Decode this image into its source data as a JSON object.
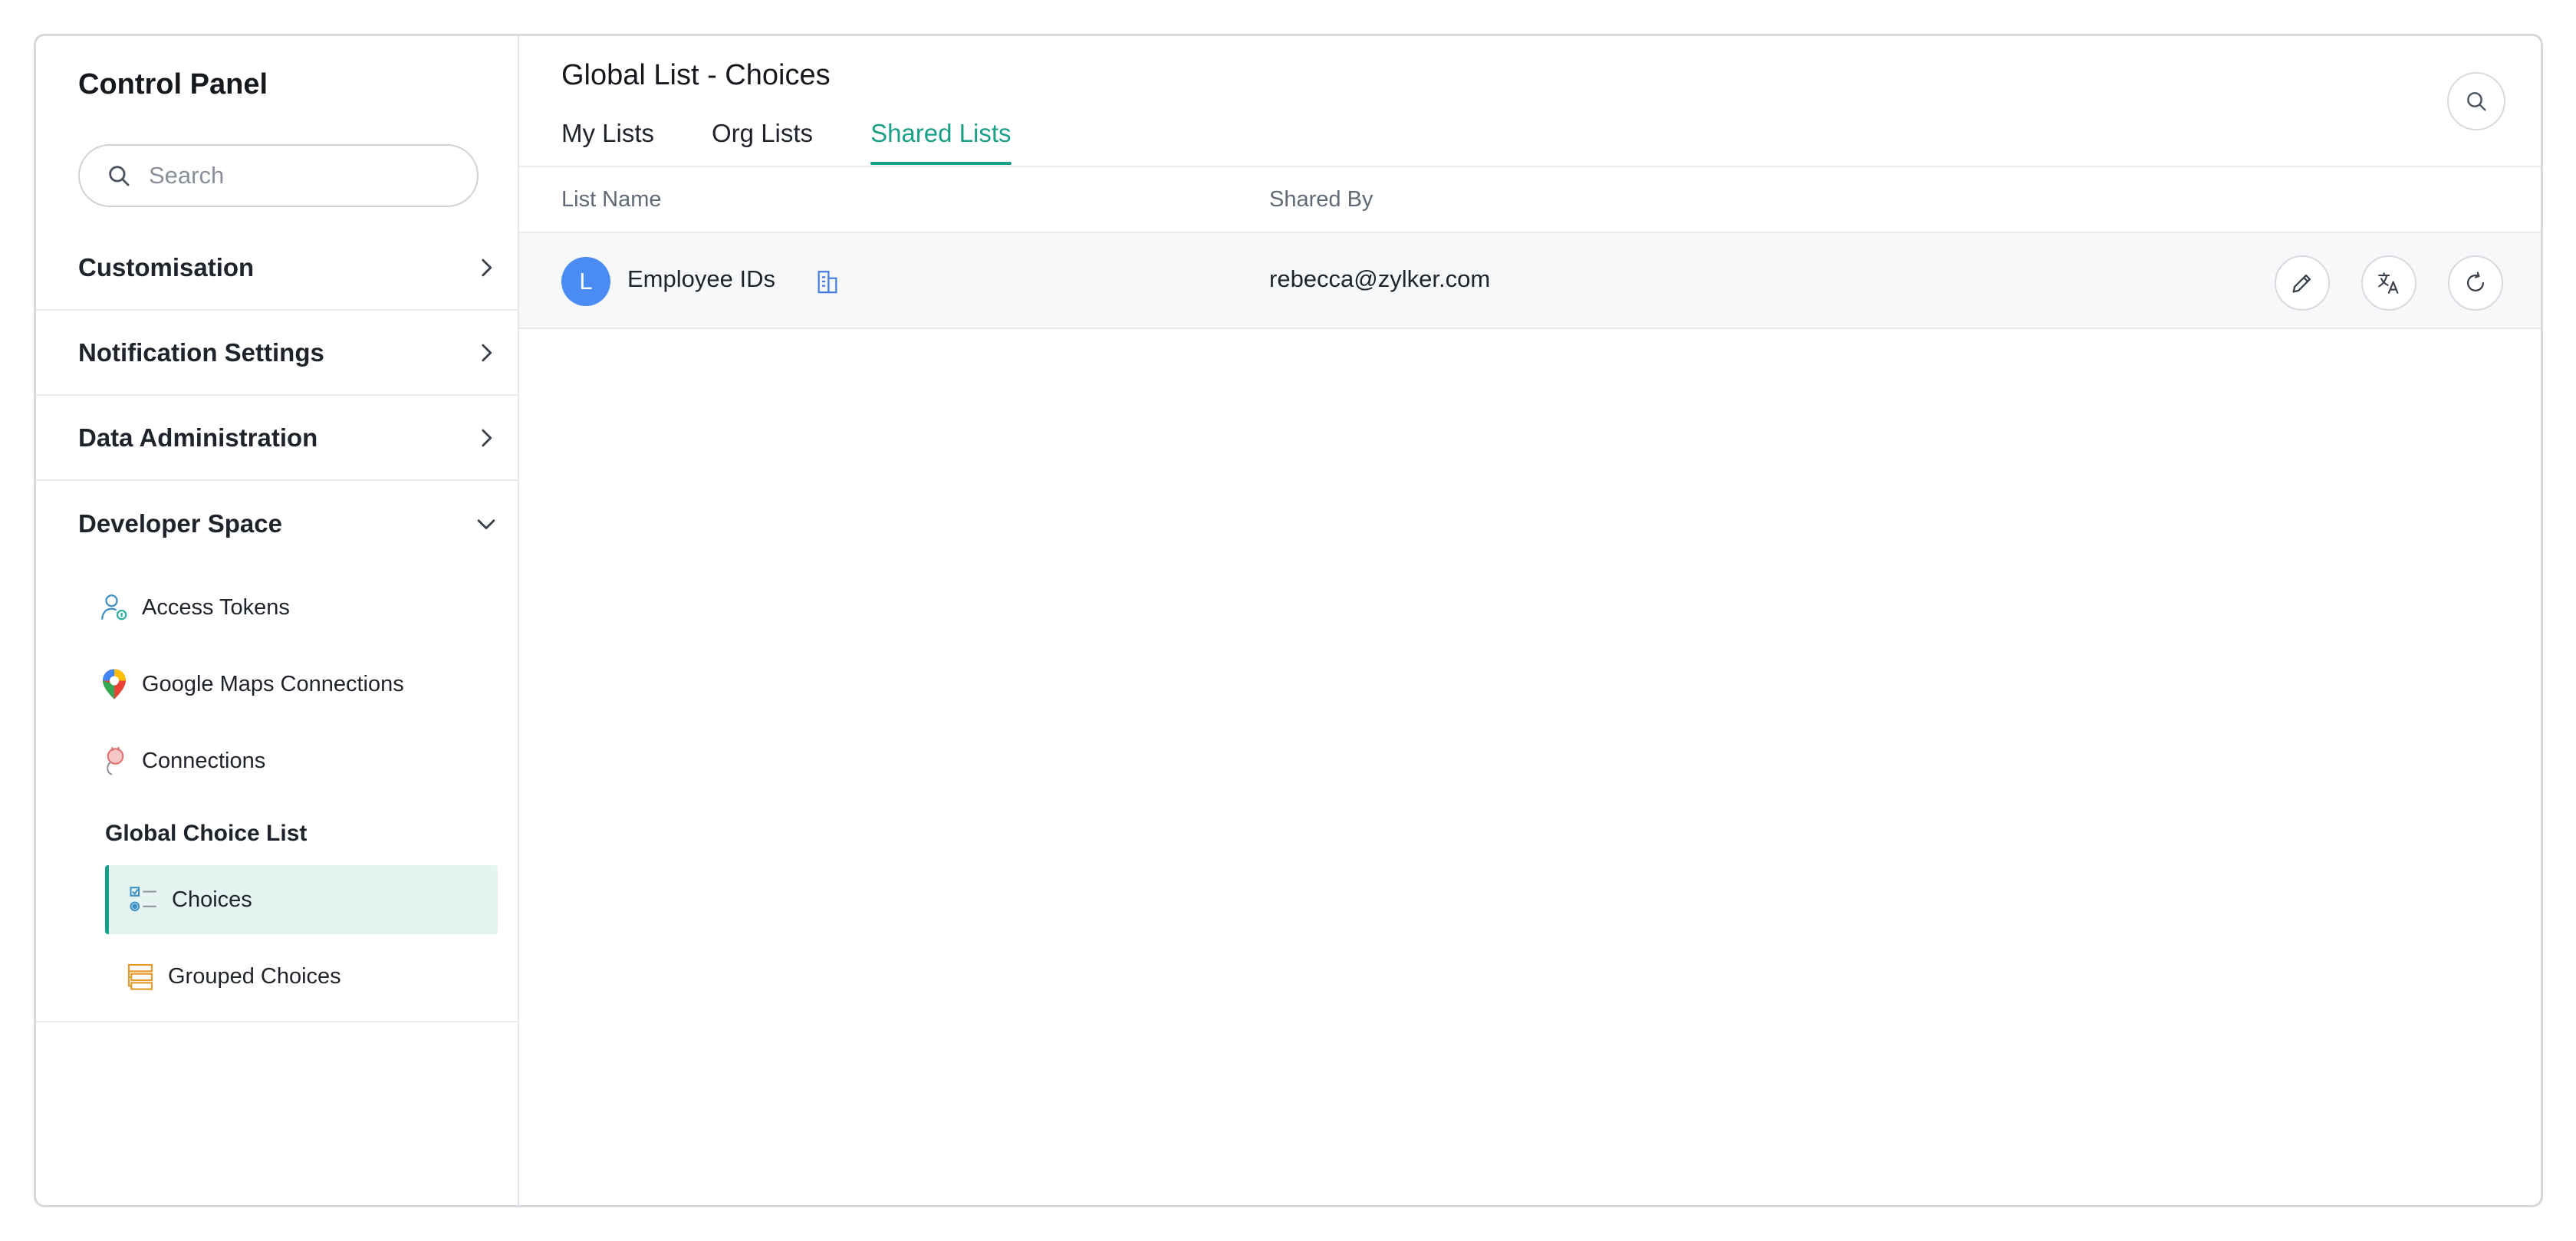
{
  "sidebar": {
    "title": "Control Panel",
    "search_placeholder": "Search",
    "sections": [
      {
        "label": "Customisation",
        "icon": "chevron-right-icon"
      },
      {
        "label": "Notification Settings",
        "icon": "chevron-right-icon"
      },
      {
        "label": "Data Administration",
        "icon": "chevron-right-icon"
      },
      {
        "label": "Developer Space",
        "icon": "chevron-down-icon"
      }
    ],
    "developer_items": [
      {
        "label": "Access Tokens",
        "icon": "user-key-icon"
      },
      {
        "label": "Google Maps Connections",
        "icon": "map-pin-icon"
      },
      {
        "label": "Connections",
        "icon": "plug-icon"
      }
    ],
    "group_title": "Global Choice List",
    "choice_items": [
      {
        "label": "Choices",
        "icon": "checklist-icon",
        "active": true
      },
      {
        "label": "Grouped Choices",
        "icon": "stack-icon",
        "active": false
      }
    ]
  },
  "main": {
    "title": "Global List - Choices",
    "tabs": [
      {
        "label": "My Lists",
        "active": false
      },
      {
        "label": "Org Lists",
        "active": false
      },
      {
        "label": "Shared Lists",
        "active": true
      }
    ],
    "columns": {
      "list_name": "List Name",
      "shared_by": "Shared By"
    },
    "rows": [
      {
        "avatar_letter": "L",
        "name": "Employee IDs",
        "shared_by": "rebecca@zylker.com",
        "actions": [
          "edit-icon",
          "translate-icon",
          "refresh-icon"
        ]
      }
    ]
  },
  "colors": {
    "accent": "#1aa087",
    "avatar": "#4a8cf3",
    "active_bg": "#e6f4f1"
  }
}
